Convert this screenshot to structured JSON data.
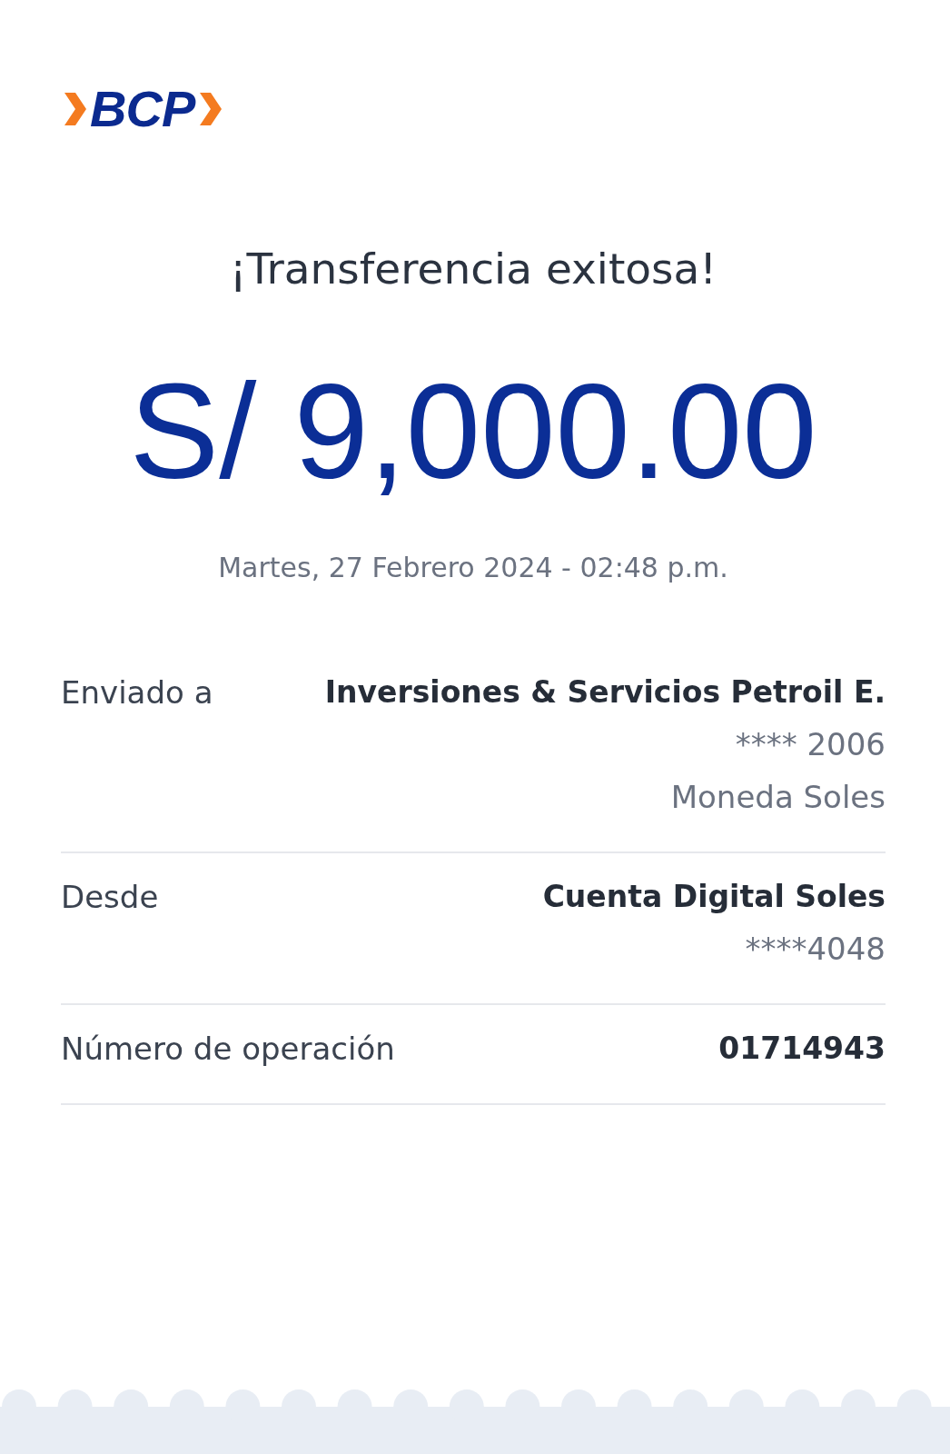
{
  "logo": {
    "text": "BCP"
  },
  "title": "¡Transferencia exitosa!",
  "amount": "S/ 9,000.00",
  "datetime": "Martes, 27 Febrero 2024 - 02:48 p.m.",
  "details": [
    {
      "label": "Enviado a",
      "values": [
        {
          "text": "Inversiones & Servicios Petroil E.",
          "kind": "primary"
        },
        {
          "text": "**** 2006",
          "kind": "secondary"
        },
        {
          "text": "Moneda Soles",
          "kind": "secondary"
        }
      ]
    },
    {
      "label": "Desde",
      "values": [
        {
          "text": "Cuenta Digital Soles",
          "kind": "primary"
        },
        {
          "text": "****4048",
          "kind": "secondary"
        }
      ]
    },
    {
      "label": "Número de operación",
      "values": [
        {
          "text": "01714943",
          "kind": "primary"
        }
      ]
    }
  ]
}
